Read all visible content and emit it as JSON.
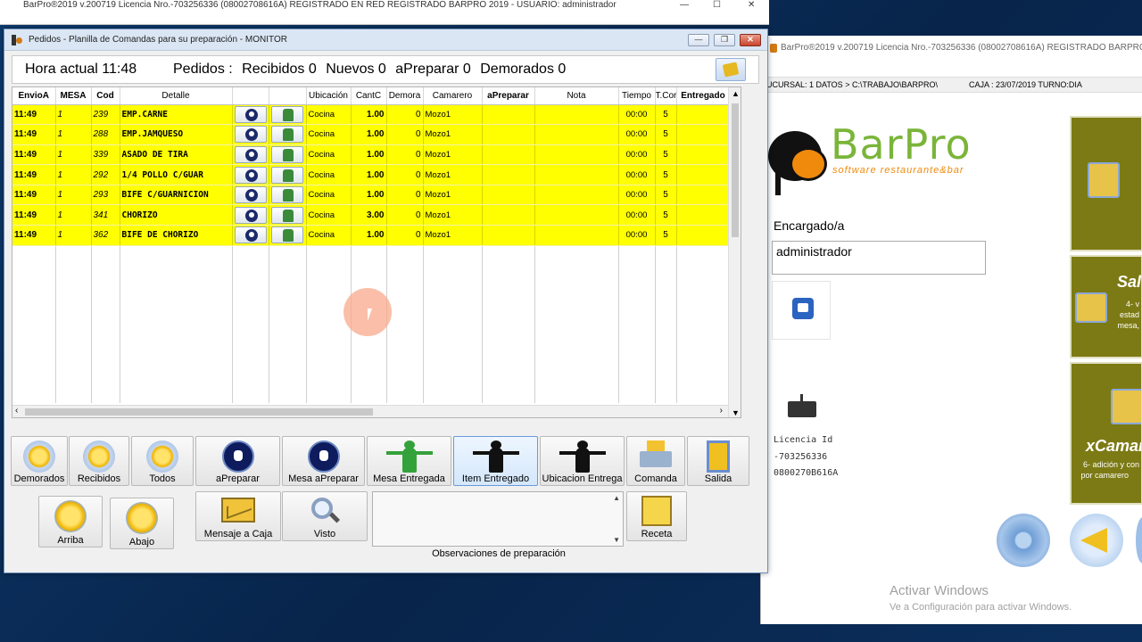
{
  "background_window": {
    "title": "BarPro®2019 v.200719 Licencia Nro.-703256336 (08002708616A) REGISTRADO EN RED REGISTRADO    BARPRO 2019 - USUARIO: administrador"
  },
  "right_window": {
    "title": "BarPro®2019 v.200719 Licencia Nro.-703256336 (08002708616A) REGISTRADO   BARPRO 20",
    "path": "UCURSAL: 1 DATOS > C:\\TRABAJO\\BARPRO\\",
    "caja": "CAJA : 23/07/2019 TURNO:DIA",
    "logo_name": "BarPro",
    "logo_tagline": "software restaurante&bar",
    "encargado_label": "Encargado/a",
    "encargado_value": "administrador",
    "licencia_label": "Licencia Id",
    "licencia_id": "-703256336",
    "licencia_code": "0800270B616A",
    "side_tile_2_title": "Sal",
    "side_tile_2_sub1": "4- v",
    "side_tile_2_sub2": "estad",
    "side_tile_2_sub3": "mesa,",
    "side_tile_3_title": "xCamar",
    "side_tile_3_sub1": "6- adición y con",
    "side_tile_3_sub2": "por camarero",
    "activate_title": "Activar Windows",
    "activate_sub": "Ve a Configuración para activar Windows."
  },
  "window": {
    "title": "Pedidos - Planilla de Comandas para su preparación - MONITOR",
    "minimize": "—",
    "maximize": "❐",
    "close": "✕"
  },
  "header": {
    "hora_label": "Hora actual 11:48",
    "pedidos_label": "Pedidos :",
    "recibidos": "Recibidos 0",
    "nuevos": "Nuevos 0",
    "apreparar": "aPreparar 0",
    "demorados": "Demorados 0"
  },
  "grid": {
    "columns": [
      "EnvioA",
      "MESA",
      "Cod",
      "Detalle",
      "",
      "",
      "Ubicación",
      "CantC",
      "Demora",
      "Camarero",
      "aPreparar",
      "Nota",
      "Tiempo",
      "T.Cor",
      "Entregado"
    ],
    "rows": [
      {
        "envio": "11:49",
        "mesa": "1",
        "cod": "239",
        "detalle": "EMP.CARNE",
        "ubicacion": "Cocina",
        "cant": "1.00",
        "demora": "0",
        "camarero": "Mozo1",
        "tiempo": "00:00",
        "tcor": "5"
      },
      {
        "envio": "11:49",
        "mesa": "1",
        "cod": "288",
        "detalle": "EMP.JAMQUESO",
        "ubicacion": "Cocina",
        "cant": "1.00",
        "demora": "0",
        "camarero": "Mozo1",
        "tiempo": "00:00",
        "tcor": "5"
      },
      {
        "envio": "11:49",
        "mesa": "1",
        "cod": "339",
        "detalle": "ASADO DE TIRA",
        "ubicacion": "Cocina",
        "cant": "1.00",
        "demora": "0",
        "camarero": "Mozo1",
        "tiempo": "00:00",
        "tcor": "5"
      },
      {
        "envio": "11:49",
        "mesa": "1",
        "cod": "292",
        "detalle": "1/4 POLLO C/GUAR",
        "ubicacion": "Cocina",
        "cant": "1.00",
        "demora": "0",
        "camarero": "Mozo1",
        "tiempo": "00:00",
        "tcor": "5"
      },
      {
        "envio": "11:49",
        "mesa": "1",
        "cod": "293",
        "detalle": "BIFE C/GUARNICION",
        "ubicacion": "Cocina",
        "cant": "1.00",
        "demora": "0",
        "camarero": "Mozo1",
        "tiempo": "00:00",
        "tcor": "5"
      },
      {
        "envio": "11:49",
        "mesa": "1",
        "cod": "341",
        "detalle": "CHORIZO",
        "ubicacion": "Cocina",
        "cant": "3.00",
        "demora": "0",
        "camarero": "Mozo1",
        "tiempo": "00:00",
        "tcor": "5"
      },
      {
        "envio": "11:49",
        "mesa": "1",
        "cod": "362",
        "detalle": "BIFE DE CHORIZO",
        "ubicacion": "Cocina",
        "cant": "1.00",
        "demora": "0",
        "camarero": "Mozo1",
        "tiempo": "00:00",
        "tcor": "5"
      }
    ]
  },
  "toolbar": {
    "demorados": "Demorados",
    "recibidos": "Recibidos",
    "todos": "Todos",
    "apreparar": "aPreparar",
    "mesa_apreparar": "Mesa aPreparar",
    "mesa_entregada": "Mesa Entregada",
    "item_entregado": "Item Entregado",
    "ubicacion_entrega": "Ubicacion Entrega",
    "comanda": "Comanda",
    "salida": "Salida",
    "arriba": "Arriba",
    "abajo": "Abajo",
    "mensaje_caja": "Mensaje a Caja",
    "visto": "Visto",
    "receta": "Receta",
    "observaciones_label": "Observaciones de preparación"
  }
}
